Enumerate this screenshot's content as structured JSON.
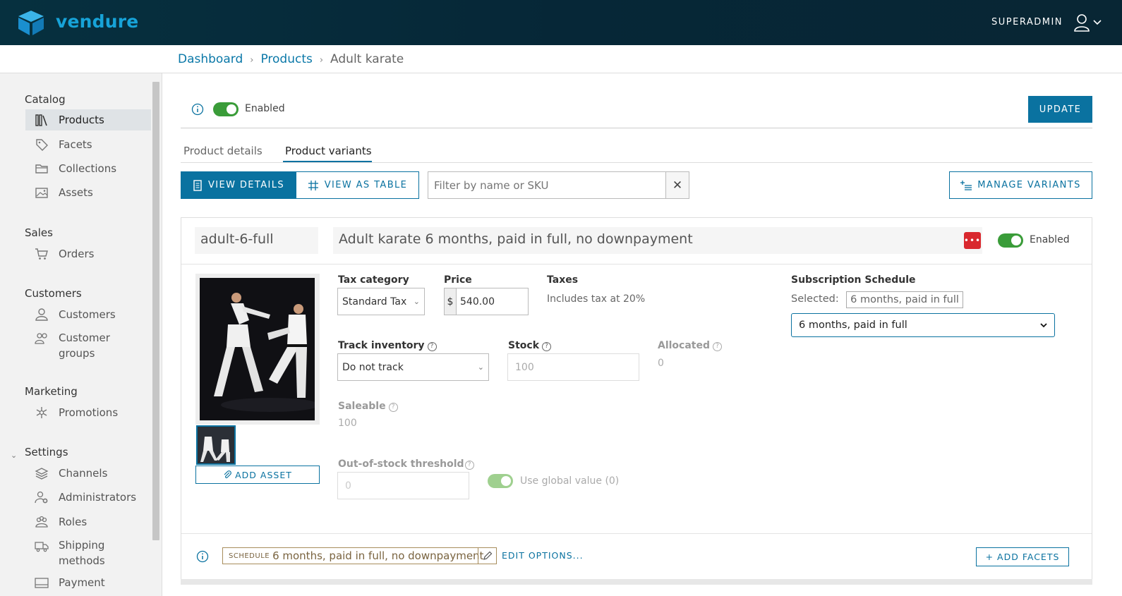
{
  "header": {
    "brand": "vendure",
    "user": "SUPERADMIN"
  },
  "breadcrumb": {
    "items": [
      "Dashboard",
      "Products"
    ],
    "current": "Adult karate",
    "separator": "›"
  },
  "sidebar": {
    "sections": [
      {
        "title": "Catalog",
        "items": [
          "Products",
          "Facets",
          "Collections",
          "Assets"
        ]
      },
      {
        "title": "Sales",
        "items": [
          "Orders"
        ]
      },
      {
        "title": "Customers",
        "items": [
          "Customers",
          "Customer groups"
        ]
      },
      {
        "title": "Marketing",
        "items": [
          "Promotions"
        ]
      },
      {
        "title": "Settings",
        "items": [
          "Channels",
          "Administrators",
          "Roles",
          "Shipping methods",
          "Payment"
        ]
      }
    ],
    "active_item": "Products"
  },
  "product": {
    "enabled_label": "Enabled",
    "update_label": "UPDATE"
  },
  "tabs": [
    "Product details",
    "Product variants"
  ],
  "active_tab": "Product variants",
  "toolbar": {
    "view_details": "VIEW DETAILS",
    "view_table": "VIEW AS TABLE",
    "filter_placeholder": "Filter by name or SKU",
    "manage_variants": "MANAGE VARIANTS"
  },
  "variant": {
    "sku": "adult-6-full",
    "name": "Adult karate 6 months, paid in full, no downpayment",
    "enabled_label": "Enabled",
    "add_asset": "ADD ASSET",
    "tax_category_label": "Tax category",
    "tax_category_value": "Standard Tax",
    "price_label": "Price",
    "currency": "$",
    "price_value": "540.00",
    "taxes_label": "Taxes",
    "taxes_value": "Includes tax at 20%",
    "subscription_label": "Subscription Schedule",
    "selected_label": "Selected:",
    "selected_value": "6 months, paid in full",
    "schedule_select_value": "6 months, paid in full",
    "track_inventory_label": "Track inventory",
    "track_inventory_value": "Do not track",
    "stock_label": "Stock",
    "stock_value": "100",
    "allocated_label": "Allocated",
    "allocated_value": "0",
    "saleable_label": "Saleable",
    "saleable_value": "100",
    "oos_label": "Out-of-stock threshold",
    "oos_value": "0",
    "use_global_label": "Use global value (0)",
    "option_group": "SCHEDULE",
    "option_value": "6 months, paid in full, no downpayment",
    "edit_options": "EDIT OPTIONS...",
    "add_facets": "+ ADD FACETS"
  },
  "colors": {
    "brand": "#17a3d8",
    "primary": "#0a72a0",
    "toggle_on": "#3a9c39",
    "header_bg": "#062737",
    "danger": "#d9282e"
  }
}
